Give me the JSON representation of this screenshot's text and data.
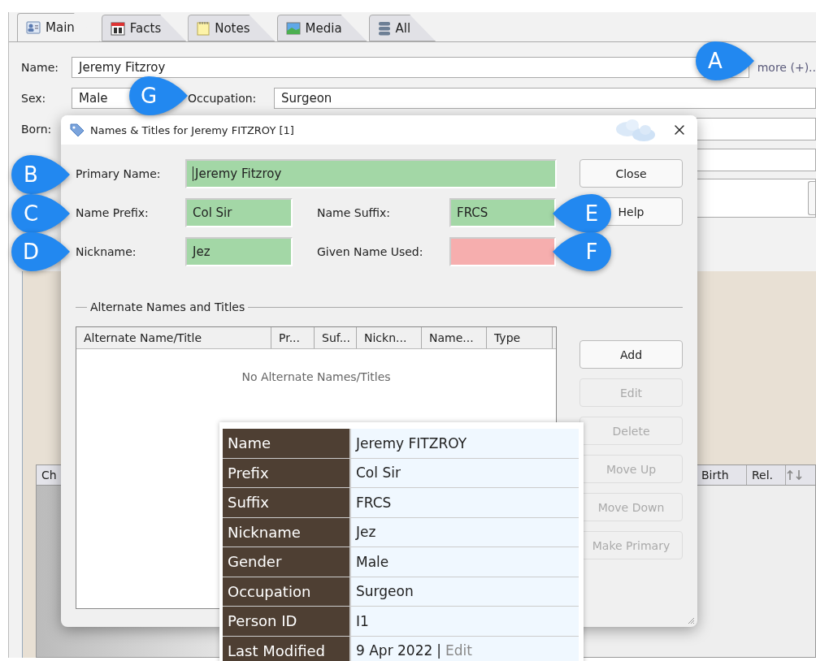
{
  "main_window": {
    "tabs": [
      {
        "label": "Main",
        "selected": true
      },
      {
        "label": "Facts",
        "selected": false
      },
      {
        "label": "Notes",
        "selected": false
      },
      {
        "label": "Media",
        "selected": false
      },
      {
        "label": "All",
        "selected": false
      }
    ],
    "name": {
      "label": "Name:",
      "value": "Jeremy Fitzroy",
      "more_link": "more (+).."
    },
    "sex": {
      "label": "Sex:",
      "value": "Male"
    },
    "occupation": {
      "label": "Occupation:",
      "value": "Surgeon"
    },
    "born_label": "Born:",
    "children_grid": {
      "columns": [
        "Ch",
        "Birth",
        "Rel."
      ]
    }
  },
  "dialog": {
    "title": "Names & Titles for Jeremy FITZROY [1]",
    "primary_name": {
      "label": "Primary Name:",
      "value": "Jeremy Fitzroy",
      "valid": true
    },
    "name_prefix": {
      "label": "Name Prefix:",
      "value": "Col Sir",
      "valid": true
    },
    "name_suffix": {
      "label": "Name Suffix:",
      "value": "FRCS",
      "valid": true
    },
    "nickname": {
      "label": "Nickname:",
      "value": "Jez",
      "valid": true
    },
    "given_name_used": {
      "label": "Given Name Used:",
      "valid": false
    },
    "top_buttons": [
      {
        "label": "Close",
        "disabled": false
      },
      {
        "label": "Help",
        "disabled": false
      }
    ],
    "group_title": "Alternate Names and Titles",
    "table": {
      "columns": [
        "Alternate Name/Title",
        "Pr...",
        "Suf...",
        "Nickn...",
        "Name...",
        "Type"
      ],
      "empty_text": "No Alternate Names/Titles"
    },
    "side_buttons": [
      {
        "label": "Add",
        "disabled": false
      },
      {
        "label": "Edit",
        "disabled": true
      },
      {
        "label": "Delete",
        "disabled": true
      },
      {
        "label": "Move Up",
        "disabled": true
      },
      {
        "label": "Move Down",
        "disabled": true
      },
      {
        "label": "Make Primary",
        "disabled": true
      }
    ]
  },
  "tooltip": {
    "rows": [
      {
        "label": "Name",
        "value": "Jeremy FITZROY"
      },
      {
        "label": "Prefix",
        "value": "Col Sir"
      },
      {
        "label": "Suffix",
        "value": "FRCS"
      },
      {
        "label": "Nickname",
        "value": "Jez"
      },
      {
        "label": "Gender",
        "value": "Male"
      },
      {
        "label": "Occupation",
        "value": "Surgeon"
      },
      {
        "label": "Person ID",
        "value": "I1"
      },
      {
        "label": "Last Modified",
        "value": "9 Apr 2022",
        "separator": "|",
        "link": "Edit"
      }
    ]
  },
  "callouts": [
    {
      "letter": "A",
      "points_left": false
    },
    {
      "letter": "G",
      "points_left": false
    },
    {
      "letter": "B",
      "points_left": false
    },
    {
      "letter": "C",
      "points_left": false
    },
    {
      "letter": "D",
      "points_left": false
    },
    {
      "letter": "E",
      "points_left": true
    },
    {
      "letter": "F",
      "points_left": true
    }
  ]
}
